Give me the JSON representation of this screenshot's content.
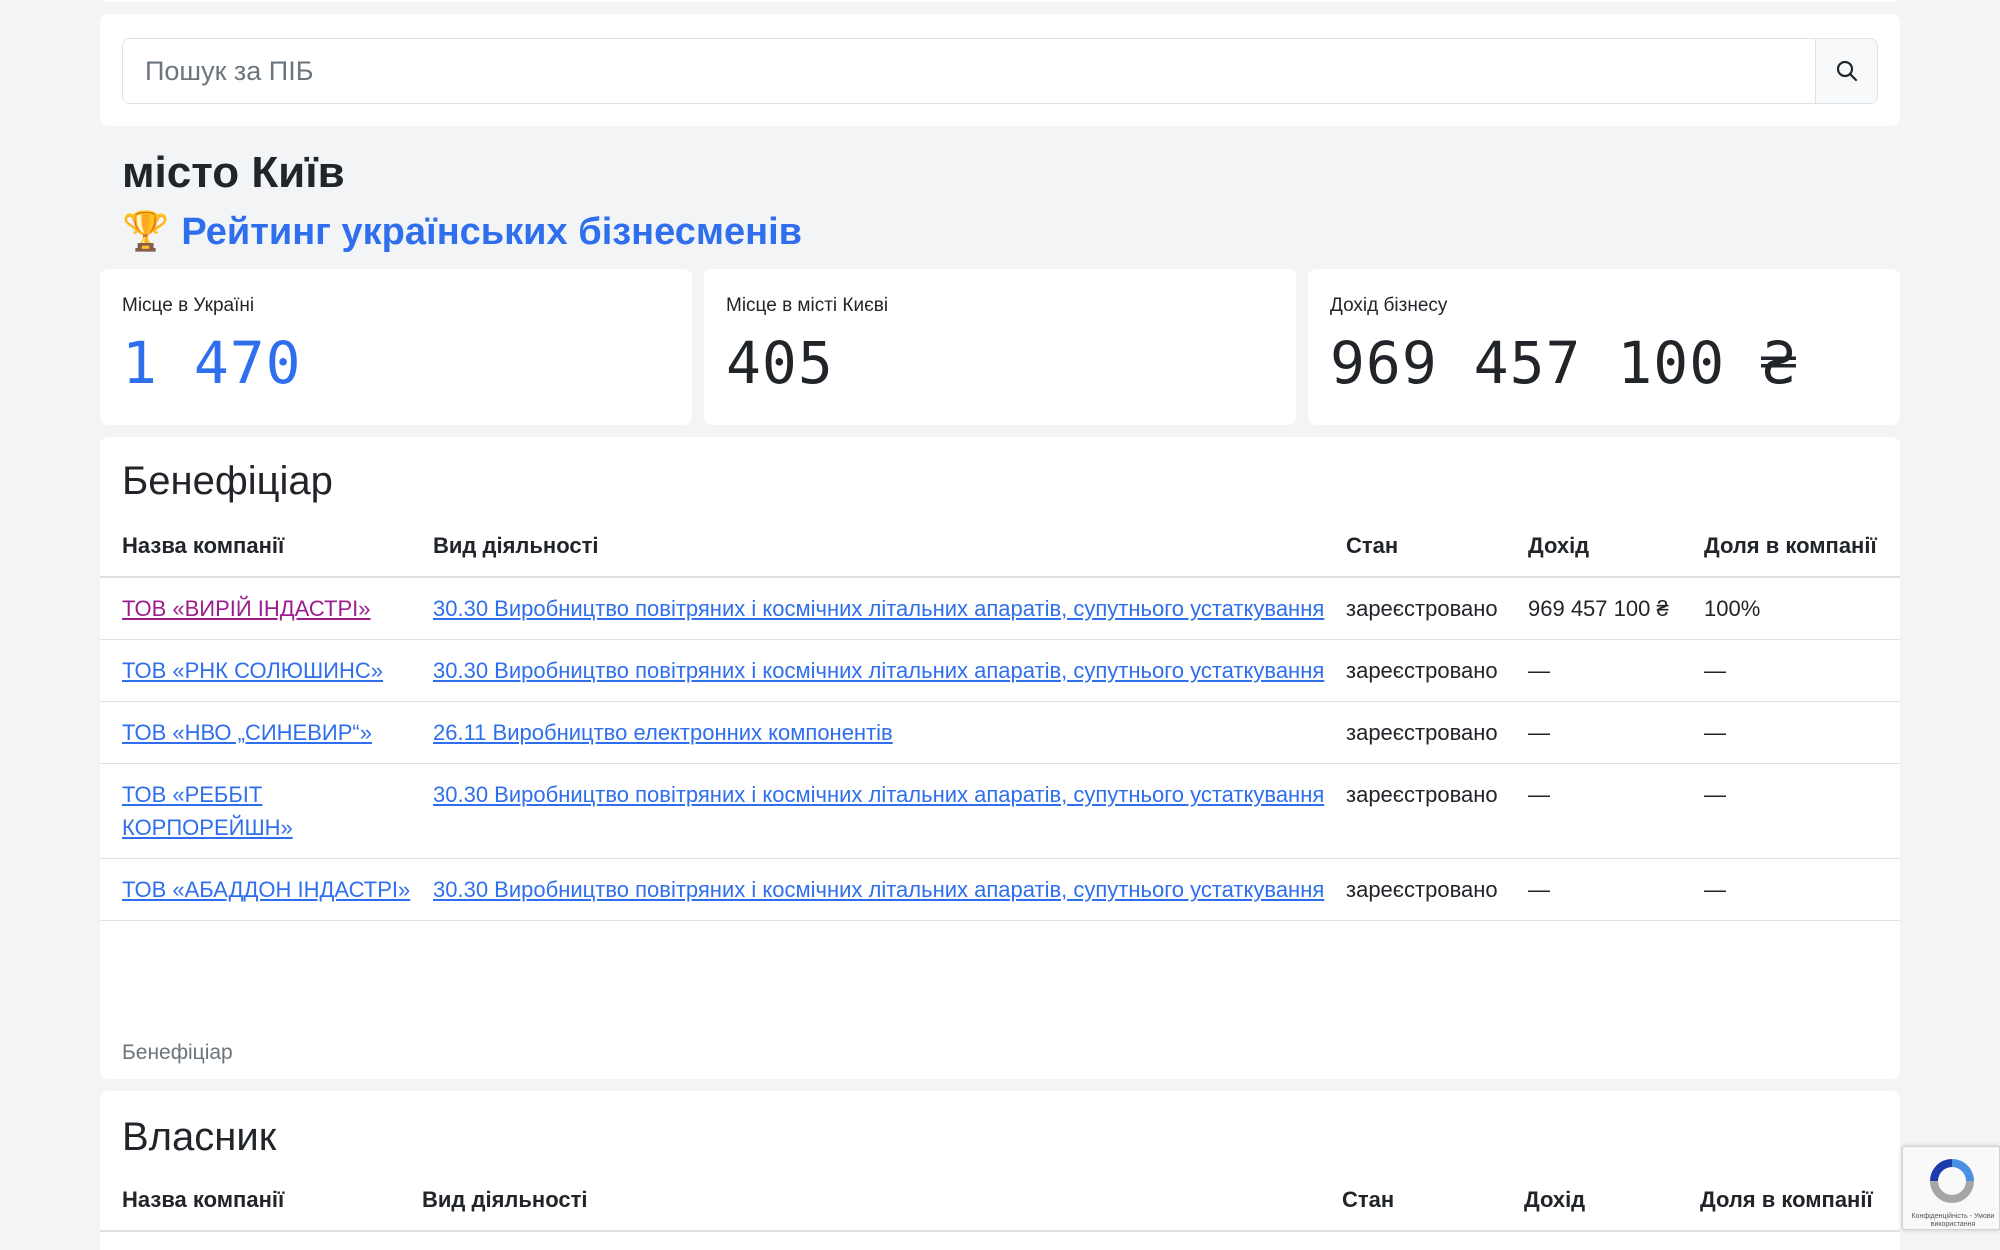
{
  "search": {
    "placeholder": "Пошук за ПІБ",
    "button_icon": "search-icon"
  },
  "header": {
    "city": "місто Київ",
    "rating_emoji": "🏆",
    "rating_link": "Рейтинг українських бізнесменів"
  },
  "stats": [
    {
      "label": "Місце в Україні",
      "value": "1 470",
      "accent": "#2f6fed"
    },
    {
      "label": "Місце в місті Києві",
      "value": "405"
    },
    {
      "label": "Дохід бізнесу",
      "value": "969 457 100 ₴"
    }
  ],
  "beneficiary": {
    "title": "Бенефіціар",
    "columns": [
      "Назва компанії",
      "Вид діяльності",
      "Стан",
      "Дохід",
      "Доля в компанії"
    ],
    "rows": [
      {
        "company": "ТОВ «ВИРІЙ ІНДАСТРІ»",
        "visited": true,
        "activity": "30.30 Виробництво повітряних і космічних літальних апаратів, супутнього устаткування",
        "status": "зареєстровано",
        "income": "969 457 100 ₴",
        "share": "100%"
      },
      {
        "company": "ТОВ «РНК СОЛЮШИНС»",
        "activity": "30.30 Виробництво повітряних і космічних літальних апаратів, супутнього устаткування",
        "status": "зареєстровано",
        "income": "—",
        "share": "—"
      },
      {
        "company": "ТОВ «НВО „СИНЕВИР“»",
        "activity": "26.11 Виробництво електронних компонентів",
        "status": "зареєстровано",
        "income": "—",
        "share": "—"
      },
      {
        "company": "ТОВ «РЕББІТ КОРПОРЕЙШН»",
        "activity": "30.30 Виробництво повітряних і космічних літальних апаратів, супутнього устаткування",
        "status": "зареєстровано",
        "income": "—",
        "share": "—"
      },
      {
        "company": "ТОВ «АБАДДОН ІНДАСТРІ»",
        "activity": "30.30 Виробництво повітряних і космічних літальних апаратів, супутнього устаткування",
        "status": "зареєстровано",
        "income": "—",
        "share": "—"
      }
    ],
    "caption": "Бенефіціар"
  },
  "owner": {
    "title": "Власник",
    "columns": [
      "Назва компанії",
      "Вид діяльності",
      "Стан",
      "Дохід",
      "Доля в компанії"
    ]
  },
  "recaptcha": {
    "text": "Конфіденційність - Умови використання"
  },
  "colors": {
    "link": "#2f6fed",
    "visited_link": "#9c1e8e",
    "background": "#f3f4f6"
  }
}
